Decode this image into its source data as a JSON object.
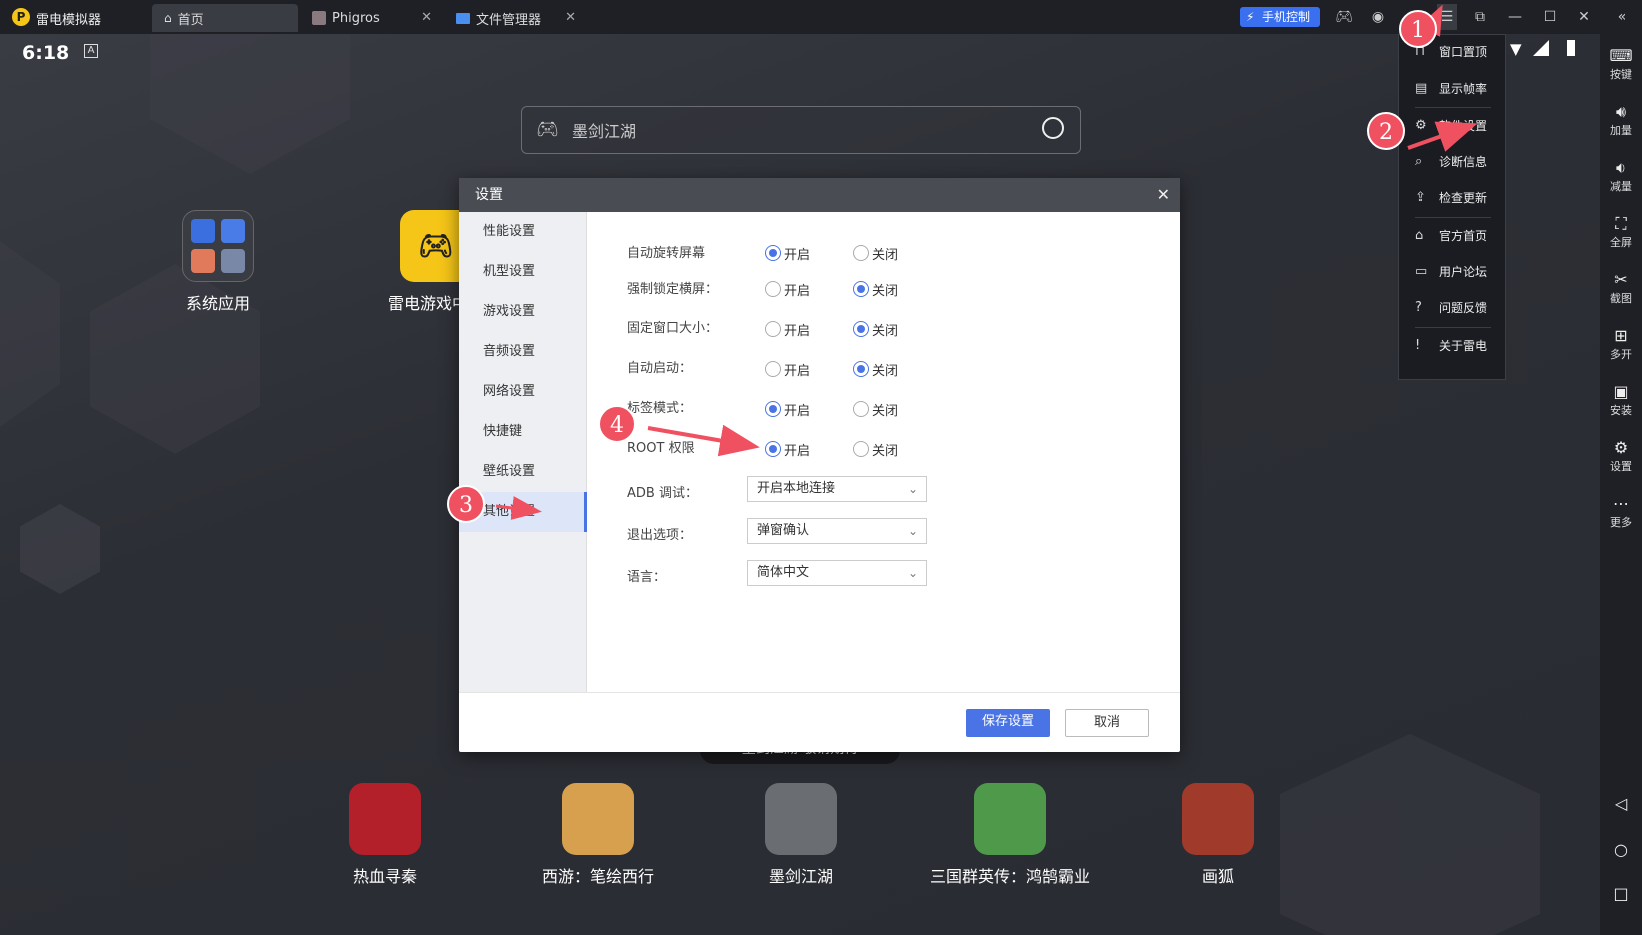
{
  "titlebar": {
    "app_name": "雷电模拟器",
    "tabs": [
      {
        "label": "首页",
        "icon": "home-icon"
      },
      {
        "label": "Phigros",
        "icon": "game-thumbnail-icon"
      },
      {
        "label": "文件管理器",
        "icon": "folder-icon"
      }
    ],
    "phone_control_label": "手机控制"
  },
  "statusbar": {
    "time": "6:18",
    "notif_icon": "A"
  },
  "search": {
    "placeholder": "墨剑江湖"
  },
  "desktop_apps": [
    {
      "name": "系统应用"
    },
    {
      "name": "雷电游戏中心"
    }
  ],
  "dock_apps": [
    {
      "name": "热血寻秦",
      "color": "#b3202a"
    },
    {
      "name": "西游：笔绘西行",
      "color": "#d6a04e"
    },
    {
      "name": "墨剑江湖",
      "color": "#6a6d72"
    },
    {
      "name": "三国群英传：鸿鹄霸业",
      "color": "#4e9a4a"
    },
    {
      "name": "画狐",
      "color": "#a03a2a"
    }
  ],
  "dock_tooltip": "墨剑江湖·敬请期待",
  "settings_dialog": {
    "title": "设置",
    "sidebar": [
      "性能设置",
      "机型设置",
      "游戏设置",
      "音频设置",
      "网络设置",
      "快捷键",
      "壁纸设置",
      "其他设置"
    ],
    "active_index": 7,
    "options": [
      {
        "label": "自动旋转屏幕",
        "on": "开启",
        "off": "关闭",
        "selected": "on"
      },
      {
        "label": "强制锁定横屏：",
        "on": "开启",
        "off": "关闭",
        "selected": "off"
      },
      {
        "label": "固定窗口大小：",
        "on": "开启",
        "off": "关闭",
        "selected": "off"
      },
      {
        "label": "自动启动：",
        "on": "开启",
        "off": "关闭",
        "selected": "off"
      },
      {
        "label": "标签模式：",
        "on": "开启",
        "off": "关闭",
        "selected": "on"
      },
      {
        "label": "ROOT 权限",
        "on": "开启",
        "off": "关闭",
        "selected": "on"
      }
    ],
    "selects": [
      {
        "label": "ADB 调试：",
        "value": "开启本地连接"
      },
      {
        "label": "退出选项：",
        "value": "弹窗确认"
      },
      {
        "label": "语言：",
        "value": "简体中文"
      }
    ],
    "save_label": "保存设置",
    "cancel_label": "取消",
    "accent": "#4a74e6"
  },
  "menu": {
    "items": [
      {
        "label": "窗口置顶",
        "icon": "pin-icon"
      },
      {
        "label": "显示帧率",
        "icon": "fps-icon"
      },
      {
        "label": "软件设置",
        "icon": "gear-icon"
      },
      {
        "label": "诊断信息",
        "icon": "search-icon"
      },
      {
        "label": "检查更新",
        "icon": "upload-icon"
      },
      {
        "label": "官方首页",
        "icon": "home-icon"
      },
      {
        "label": "用户论坛",
        "icon": "forum-icon"
      },
      {
        "label": "问题反馈",
        "icon": "help-icon"
      },
      {
        "label": "关于雷电",
        "icon": "info-icon"
      }
    ]
  },
  "right_toolbar": [
    "按键",
    "加量",
    "减量",
    "全屏",
    "截图",
    "多开",
    "安装",
    "设置",
    "更多"
  ],
  "annotations": [
    "1",
    "2",
    "3",
    "4"
  ]
}
